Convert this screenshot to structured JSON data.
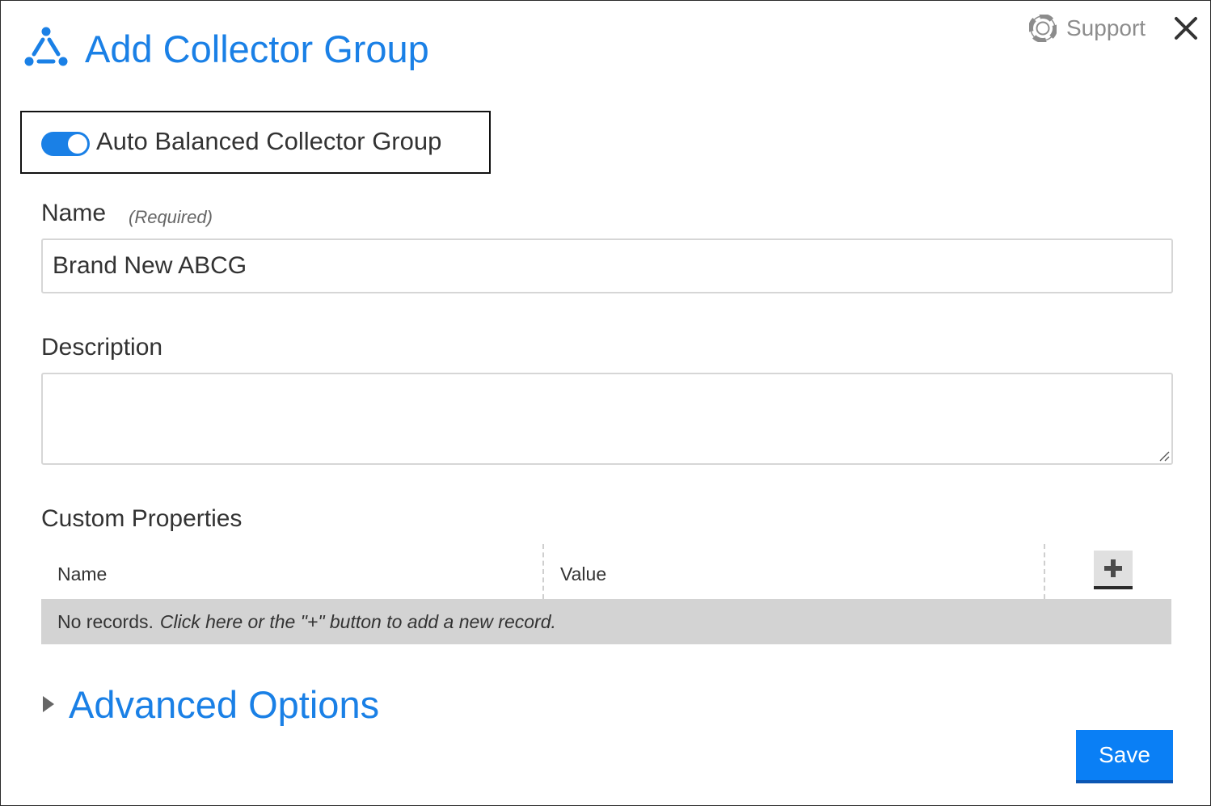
{
  "header": {
    "title": "Add Collector Group",
    "support_label": "Support",
    "accent_color": "#1a80e6",
    "logo_icon": "collector-group-icon",
    "support_icon": "lifebuoy-icon",
    "close_icon": "close-icon"
  },
  "auto_balanced": {
    "label": "Auto Balanced Collector Group",
    "enabled": true
  },
  "name_field": {
    "label": "Name",
    "hint": "(Required)",
    "value": "Brand New ABCG"
  },
  "description_field": {
    "label": "Description",
    "value": ""
  },
  "custom_properties": {
    "title": "Custom Properties",
    "columns": [
      "Name",
      "Value"
    ],
    "add_icon": "plus-icon",
    "empty_message": "No records.",
    "empty_hint": "Click here or the \"+\" button to add a new record."
  },
  "advanced": {
    "label": "Advanced Options",
    "expanded": false
  },
  "footer": {
    "save_label": "Save",
    "save_color": "#0a7ff5"
  }
}
